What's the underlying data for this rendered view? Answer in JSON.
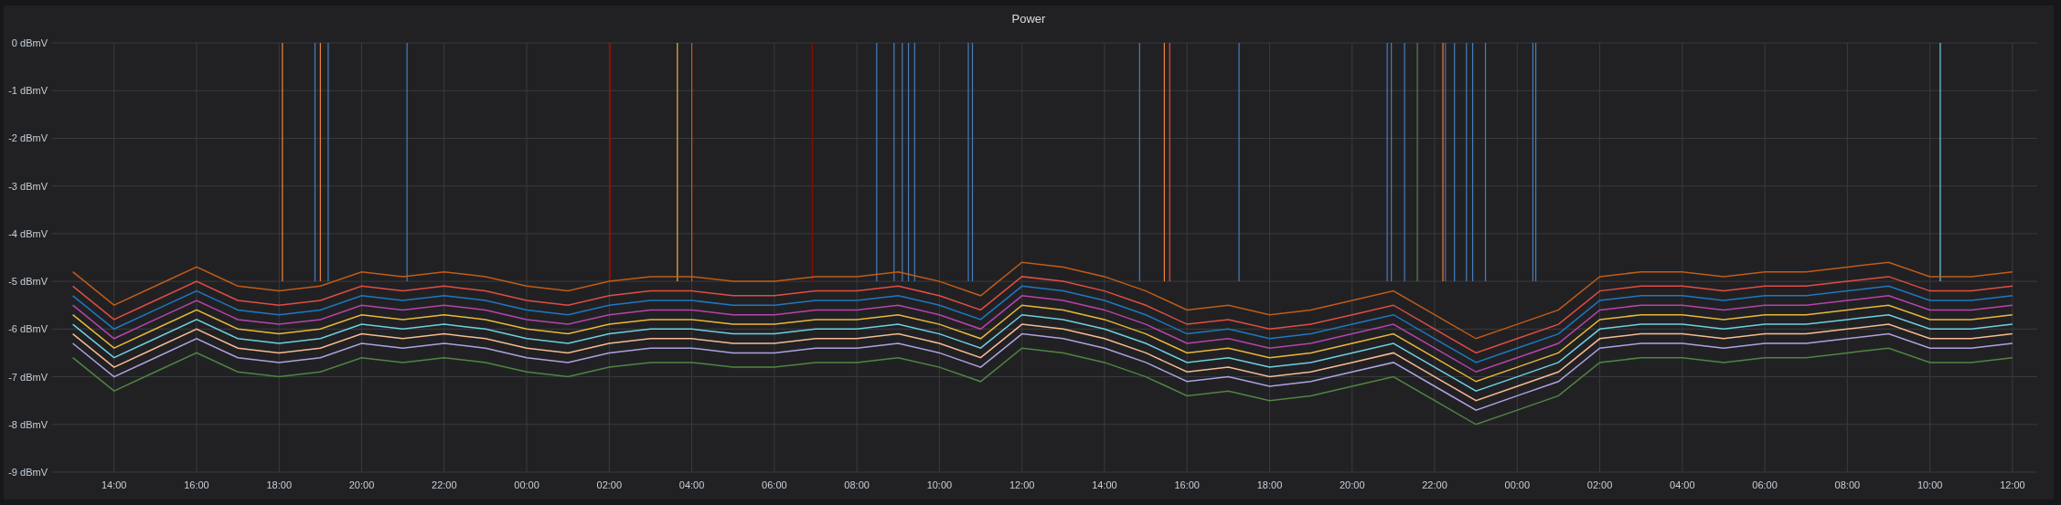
{
  "panel": {
    "title": "Power",
    "chart_data": {
      "type": "line",
      "categories": [
        null,
        "14:00",
        null,
        "16:00",
        null,
        "18:00",
        null,
        "20:00",
        null,
        "22:00",
        null,
        "00:00",
        null,
        "02:00",
        null,
        "04:00",
        null,
        "06:00",
        null,
        "08:00",
        null,
        "10:00",
        null,
        "12:00",
        null,
        "14:00",
        null,
        "16:00",
        null,
        "18:00",
        null,
        "20:00",
        null,
        "22:00",
        null,
        "00:00",
        null,
        "02:00",
        null,
        "04:00",
        null,
        "06:00",
        null,
        "08:00",
        null,
        "10:00",
        null,
        "12:00"
      ],
      "ylim": [
        -9,
        0
      ],
      "grid": true,
      "yticks": [
        {
          "value": 0,
          "label": "0 dBmV"
        },
        {
          "value": -1,
          "label": "-1 dBmV"
        },
        {
          "value": -2,
          "label": "-2 dBmV"
        },
        {
          "value": -3,
          "label": "-3 dBmV"
        },
        {
          "value": -4,
          "label": "-4 dBmV"
        },
        {
          "value": -5,
          "label": "-5 dBmV"
        },
        {
          "value": -6,
          "label": "-6 dBmV"
        },
        {
          "value": -7,
          "label": "-7 dBmV"
        },
        {
          "value": -8,
          "label": "-8 dBmV"
        },
        {
          "value": -9,
          "label": "-9 dBmV"
        }
      ],
      "series": [
        {
          "color": "#c15c17",
          "values": [
            -4.8,
            -5.5,
            -5.1,
            -4.7,
            -5.1,
            -5.2,
            -5.1,
            -4.8,
            -4.9,
            -4.8,
            -4.9,
            -5.1,
            -5.2,
            -5.0,
            -4.9,
            -4.9,
            -5.0,
            -5.0,
            -4.9,
            -4.9,
            -4.8,
            -5.0,
            -5.3,
            -4.6,
            -4.7,
            -4.9,
            -5.2,
            -5.6,
            -5.5,
            -5.7,
            -5.6,
            -5.4,
            -5.2,
            -5.7,
            -6.2,
            -5.9,
            -5.6,
            -4.9,
            -4.8,
            -4.8,
            -4.9,
            -4.8,
            -4.8,
            -4.7,
            -4.6,
            -4.9,
            -4.9,
            -4.8
          ]
        },
        {
          "color": "#e24d42",
          "values": [
            -5.1,
            -5.8,
            -5.4,
            -5.0,
            -5.4,
            -5.5,
            -5.4,
            -5.1,
            -5.2,
            -5.1,
            -5.2,
            -5.4,
            -5.5,
            -5.3,
            -5.2,
            -5.2,
            -5.3,
            -5.3,
            -5.2,
            -5.2,
            -5.1,
            -5.3,
            -5.6,
            -4.9,
            -5.0,
            -5.2,
            -5.5,
            -5.9,
            -5.8,
            -6.0,
            -5.9,
            -5.7,
            -5.5,
            -6.0,
            -6.5,
            -6.2,
            -5.9,
            -5.2,
            -5.1,
            -5.1,
            -5.2,
            -5.1,
            -5.1,
            -5.0,
            -4.9,
            -5.2,
            -5.2,
            -5.1
          ]
        },
        {
          "color": "#1f78c1",
          "values": [
            -5.3,
            -6.0,
            -5.6,
            -5.2,
            -5.6,
            -5.7,
            -5.6,
            -5.3,
            -5.4,
            -5.3,
            -5.4,
            -5.6,
            -5.7,
            -5.5,
            -5.4,
            -5.4,
            -5.5,
            -5.5,
            -5.4,
            -5.4,
            -5.3,
            -5.5,
            -5.8,
            -5.1,
            -5.2,
            -5.4,
            -5.7,
            -6.1,
            -6.0,
            -6.2,
            -6.1,
            -5.9,
            -5.7,
            -6.2,
            -6.7,
            -6.4,
            -6.1,
            -5.4,
            -5.3,
            -5.3,
            -5.4,
            -5.3,
            -5.3,
            -5.2,
            -5.1,
            -5.4,
            -5.4,
            -5.3
          ]
        },
        {
          "color": "#ba43a9",
          "values": [
            -5.5,
            -6.2,
            -5.8,
            -5.4,
            -5.8,
            -5.9,
            -5.8,
            -5.5,
            -5.6,
            -5.5,
            -5.6,
            -5.8,
            -5.9,
            -5.7,
            -5.6,
            -5.6,
            -5.7,
            -5.7,
            -5.6,
            -5.6,
            -5.5,
            -5.7,
            -6.0,
            -5.3,
            -5.4,
            -5.6,
            -5.9,
            -6.3,
            -6.2,
            -6.4,
            -6.3,
            -6.1,
            -5.9,
            -6.4,
            -6.9,
            -6.6,
            -6.3,
            -5.6,
            -5.5,
            -5.5,
            -5.6,
            -5.5,
            -5.5,
            -5.4,
            -5.3,
            -5.6,
            -5.6,
            -5.5
          ]
        },
        {
          "color": "#eab839",
          "values": [
            -5.7,
            -6.4,
            -6.0,
            -5.6,
            -6.0,
            -6.1,
            -6.0,
            -5.7,
            -5.8,
            -5.7,
            -5.8,
            -6.0,
            -6.1,
            -5.9,
            -5.8,
            -5.8,
            -5.9,
            -5.9,
            -5.8,
            -5.8,
            -5.7,
            -5.9,
            -6.2,
            -5.5,
            -5.6,
            -5.8,
            -6.1,
            -6.5,
            -6.4,
            -6.6,
            -6.5,
            -6.3,
            -6.1,
            -6.6,
            -7.1,
            -6.8,
            -6.5,
            -5.8,
            -5.7,
            -5.7,
            -5.8,
            -5.7,
            -5.7,
            -5.6,
            -5.5,
            -5.8,
            -5.8,
            -5.7
          ]
        },
        {
          "color": "#6ed0e0",
          "values": [
            -5.9,
            -6.6,
            -6.2,
            -5.8,
            -6.2,
            -6.3,
            -6.2,
            -5.9,
            -6.0,
            -5.9,
            -6.0,
            -6.2,
            -6.3,
            -6.1,
            -6.0,
            -6.0,
            -6.1,
            -6.1,
            -6.0,
            -6.0,
            -5.9,
            -6.1,
            -6.4,
            -5.7,
            -5.8,
            -6.0,
            -6.3,
            -6.7,
            -6.6,
            -6.8,
            -6.7,
            -6.5,
            -6.3,
            -6.8,
            -7.3,
            -7.0,
            -6.7,
            -6.0,
            -5.9,
            -5.9,
            -6.0,
            -5.9,
            -5.9,
            -5.8,
            -5.7,
            -6.0,
            -6.0,
            -5.9
          ]
        },
        {
          "color": "#f9ba8f",
          "values": [
            -6.1,
            -6.8,
            -6.4,
            -6.0,
            -6.4,
            -6.5,
            -6.4,
            -6.1,
            -6.2,
            -6.1,
            -6.2,
            -6.4,
            -6.5,
            -6.3,
            -6.2,
            -6.2,
            -6.3,
            -6.3,
            -6.2,
            -6.2,
            -6.1,
            -6.3,
            -6.6,
            -5.9,
            -6.0,
            -6.2,
            -6.5,
            -6.9,
            -6.8,
            -7.0,
            -6.9,
            -6.7,
            -6.5,
            -7.0,
            -7.5,
            -7.2,
            -6.9,
            -6.2,
            -6.1,
            -6.1,
            -6.2,
            -6.1,
            -6.1,
            -6.0,
            -5.9,
            -6.2,
            -6.2,
            -6.1
          ]
        },
        {
          "color": "#aea2e0",
          "values": [
            -6.3,
            -7.0,
            -6.6,
            -6.2,
            -6.6,
            -6.7,
            -6.6,
            -6.3,
            -6.4,
            -6.3,
            -6.4,
            -6.6,
            -6.7,
            -6.5,
            -6.4,
            -6.4,
            -6.5,
            -6.5,
            -6.4,
            -6.4,
            -6.3,
            -6.5,
            -6.8,
            -6.1,
            -6.2,
            -6.4,
            -6.7,
            -7.1,
            -7.0,
            -7.2,
            -7.1,
            -6.9,
            -6.7,
            -7.2,
            -7.7,
            -7.4,
            -7.1,
            -6.4,
            -6.3,
            -6.3,
            -6.4,
            -6.3,
            -6.3,
            -6.2,
            -6.1,
            -6.4,
            -6.4,
            -6.3
          ]
        },
        {
          "color": "#508642",
          "values": [
            -6.6,
            -7.3,
            -6.9,
            -6.5,
            -6.9,
            -7.0,
            -6.9,
            -6.6,
            -6.7,
            -6.6,
            -6.7,
            -6.9,
            -7.0,
            -6.8,
            -6.7,
            -6.7,
            -6.8,
            -6.8,
            -6.7,
            -6.7,
            -6.6,
            -6.8,
            -7.1,
            -6.4,
            -6.5,
            -6.7,
            -7.0,
            -7.4,
            -7.3,
            -7.5,
            -7.4,
            -7.2,
            -7.0,
            -7.5,
            -8.0,
            -7.7,
            -7.4,
            -6.7,
            -6.6,
            -6.6,
            -6.7,
            -6.6,
            -6.6,
            -6.5,
            -6.4,
            -6.7,
            -6.7,
            -6.6
          ]
        }
      ]
    }
  }
}
